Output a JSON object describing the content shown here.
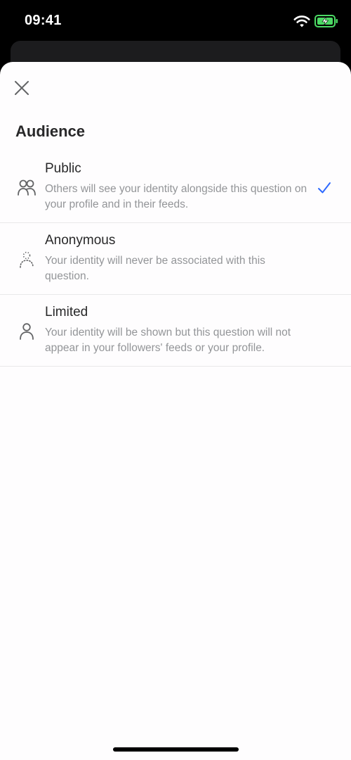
{
  "status_bar": {
    "time": "09:41"
  },
  "sheet": {
    "title": "Audience",
    "close_icon": "close-icon",
    "options": [
      {
        "title": "Public",
        "description": "Others will see your identity alongside this question on your profile and in their feeds.",
        "icon": "people-icon",
        "selected": true
      },
      {
        "title": "Anonymous",
        "description": "Your identity will never be associated with this question.",
        "icon": "anonymous-person-icon",
        "selected": false
      },
      {
        "title": "Limited",
        "description": "Your identity will be shown but this question will not appear in your followers' feeds or your profile.",
        "icon": "person-icon",
        "selected": false
      }
    ]
  },
  "colors": {
    "accent": "#2e69ff",
    "title_text": "#282829",
    "secondary_text": "#939598",
    "divider": "#e9e9ea",
    "battery": "#4cd964"
  }
}
